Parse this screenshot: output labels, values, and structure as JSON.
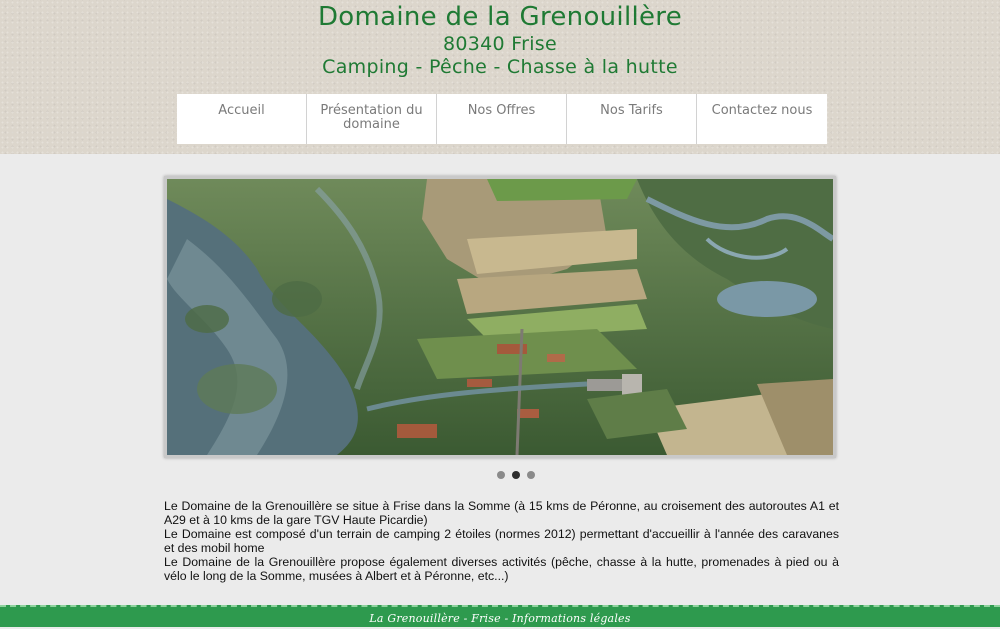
{
  "header": {
    "title": "Domaine de la Grenouillère",
    "address": "80340 Frise",
    "tagline": "Camping - Pêche - Chasse à la hutte"
  },
  "nav": {
    "items": [
      {
        "label": "Accueil"
      },
      {
        "label": "Présentation du domaine"
      },
      {
        "label": "Nos Offres"
      },
      {
        "label": "Nos Tarifs"
      },
      {
        "label": "Contactez nous"
      }
    ]
  },
  "slider": {
    "slide_count": 3,
    "active_index": 1
  },
  "content": {
    "paragraphs": [
      "Le Domaine de la Grenouillère se situe à Frise dans la Somme (à 15 kms de Péronne, au croisement des autoroutes A1 et A29 et à 10 kms de la gare TGV Haute Picardie)",
      "Le Domaine est composé d'un terrain de camping 2 étoiles (normes 2012) permettant d'accueillir à l'année des caravanes et des mobil home",
      "Le Domaine de la Grenouillère propose également diverses activités (pêche, chasse à la hutte, promenades à pied ou à vélo le long de la Somme, musées à Albert et à Péronne, etc...)"
    ]
  },
  "footer": {
    "text": "La Grenouillère - Frise - Informations légales"
  },
  "colors": {
    "title_green": "#1f7a34",
    "footer_green": "#2e9a4e"
  }
}
